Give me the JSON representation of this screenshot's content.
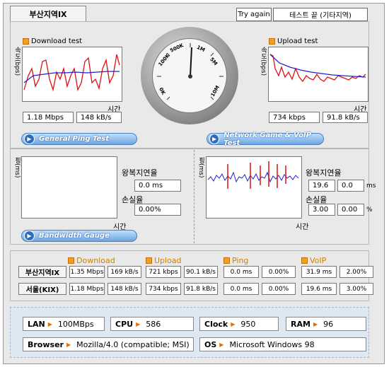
{
  "header": {
    "location_tab": "부산지역IX",
    "try_again": "Try again",
    "status": "테스트 끝 (기타지역)"
  },
  "download": {
    "title": "Download test",
    "y_axis": "속도(bps)",
    "x_axis": "시간",
    "mbps": "1.18 Mbps",
    "kbs": "148 kB/s"
  },
  "upload": {
    "title": "Upload test",
    "y_axis": "속도(bps)",
    "x_axis": "시간",
    "kbps": "734 kbps",
    "kbs": "91.8 kB/s"
  },
  "gauge": {
    "labels": [
      "0K",
      "100K",
      "500K",
      "1M",
      "5M",
      "10M"
    ]
  },
  "buttons": {
    "ping": "General Ping Test",
    "game": "Network Game & VoIP Test",
    "bandwidth": "Bandwidth Gauge"
  },
  "ping_left": {
    "y_axis": "핑(ms)",
    "x_axis": "시간",
    "rtt_label": "왕복지연율",
    "rtt_value": "0.0 ms",
    "loss_label": "손실율",
    "loss_value": "0.00%"
  },
  "ping_right": {
    "y_axis": "핑(ms)",
    "x_axis": "시간",
    "rtt_label": "왕복지연율",
    "rtt_a": "19.6",
    "rtt_b": "0.0",
    "rtt_unit": "ms",
    "loss_label": "손실율",
    "loss_a": "3.00",
    "loss_b": "0.00",
    "loss_unit": "%"
  },
  "results": {
    "columns": [
      "Download",
      "Upload",
      "Ping",
      "VoIP"
    ],
    "rows": [
      {
        "label": "부산지역IX",
        "cells": [
          "1.35 Mbps",
          "169 kB/s",
          "721 kbps",
          "90.1 kB/s",
          "0.0 ms",
          "0.00%",
          "31.9 ms",
          "2.00%"
        ]
      },
      {
        "label": "서울(KIX)",
        "cells": [
          "1.18 Mbps",
          "148 kB/s",
          "734 kbps",
          "91.8 kB/s",
          "0.0 ms",
          "0.00%",
          "19.6 ms",
          "3.00%"
        ]
      }
    ]
  },
  "system": {
    "lan_k": "LAN",
    "lan_v": "100MBps",
    "cpu_k": "CPU",
    "cpu_v": "586",
    "clock_k": "Clock",
    "clock_v": "950",
    "ram_k": "RAM",
    "ram_v": "96",
    "browser_k": "Browser",
    "browser_v": "Mozilla/4.0 (compatible; MSI)",
    "os_k": "OS",
    "os_v": "Microsoft Windows 98"
  },
  "colors": {
    "series_measured": "#dd1111",
    "series_average": "#2222cc",
    "accent_orange": "#d08000",
    "button_blue": "#6fa6e0"
  }
}
